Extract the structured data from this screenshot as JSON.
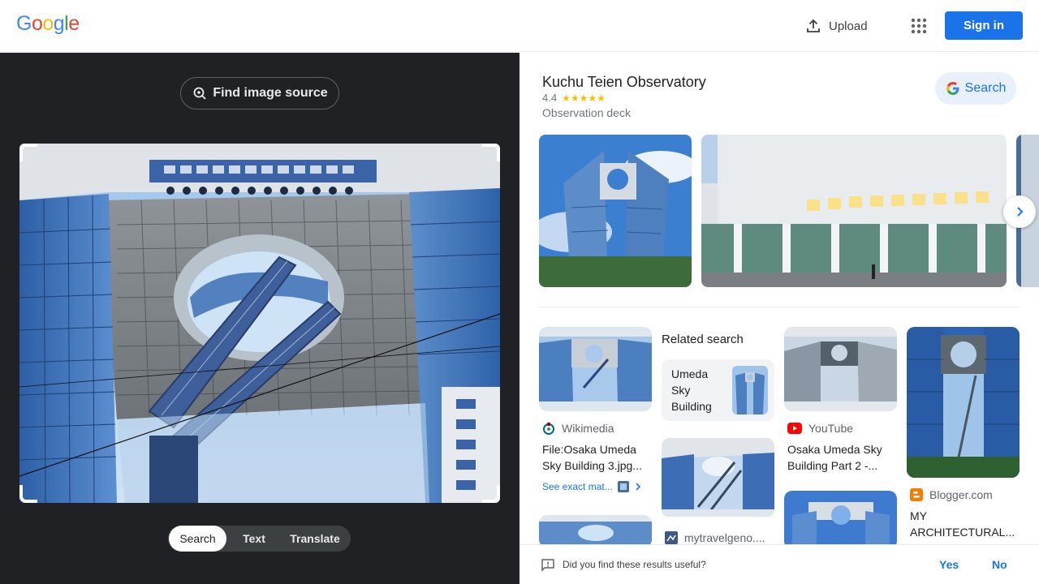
{
  "header": {
    "logo_letters": [
      "G",
      "o",
      "o",
      "g",
      "l",
      "e"
    ],
    "logo_colors": [
      "#4285f4",
      "#ea4335",
      "#fbbc05",
      "#4285f4",
      "#34a853",
      "#ea4335"
    ],
    "upload_label": "Upload",
    "apps_icon": "apps-grid-icon",
    "signin_label": "Sign in",
    "accent": "#1a73e8"
  },
  "left": {
    "find_source_label": "Find image source",
    "modes": [
      "Search",
      "Text",
      "Translate"
    ],
    "active_mode": "Search"
  },
  "entity": {
    "title": "Kuchu Teien Observatory",
    "rating": "4.4",
    "stars": "★★★★★",
    "type": "Observation deck",
    "search_label": "Search"
  },
  "results": {
    "related_heading": "Related search",
    "related_chip": "Umeda Sky Building",
    "card1": {
      "source": "Wikimedia",
      "title": "File:Osaka Umeda Sky Building 3.jpg...",
      "see_exact": "See exact mat..."
    },
    "card2": {
      "source": "YouTube",
      "title": "Osaka Umeda Sky Building Part 2 -..."
    },
    "card3": {
      "source": "Blogger.com",
      "title": "MY ARCHITECTURAL..."
    },
    "card4": {
      "source": "mytravelgeno...."
    }
  },
  "feedback": {
    "question": "Did you find these results useful?",
    "yes": "Yes",
    "no": "No"
  }
}
